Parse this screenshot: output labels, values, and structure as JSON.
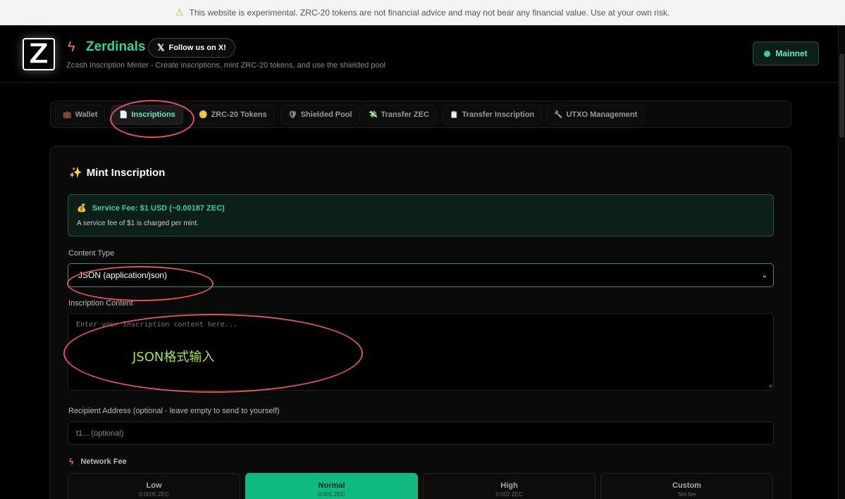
{
  "banner": {
    "icon": "warning-icon",
    "text": "This website is experimental. ZRC-20 tokens are not financial advice and may not bear any financial value. Use at your own risk."
  },
  "header": {
    "logo_text": "Z",
    "brand": "Zerdinals",
    "follow_label": "Follow us on X!",
    "x_icon": "𝕏",
    "subtitle": "Zcash Inscription Minter - Create inscriptions, mint ZRC-20 tokens, and use the shielded pool",
    "network_label": "Mainnet",
    "network_color": "#34d399"
  },
  "tabs": [
    {
      "label": "Wallet",
      "icon": "💼"
    },
    {
      "label": "Inscriptions",
      "icon": "📄",
      "active": true
    },
    {
      "label": "ZRC-20 Tokens",
      "icon": "🪙"
    },
    {
      "label": "Shielded Pool",
      "icon": "🛡"
    },
    {
      "label": "Transfer ZEC",
      "icon": "💸"
    },
    {
      "label": "Transfer Inscription",
      "icon": "📋"
    },
    {
      "label": "UTXO Management",
      "icon": "🔧"
    }
  ],
  "card": {
    "title": "Mint Inscription",
    "title_icon": "✨",
    "fee_icon": "💰",
    "fee_title": "Service Fee: $1 USD (~0.00187 ZEC)",
    "fee_desc": "A service fee of $1 is charged per mint.",
    "content_type_label": "Content Type",
    "content_type_value": "JSON (application/json)",
    "content_label": "Inscription Content",
    "content_placeholder": "Enter your inscription content here...",
    "annotation": "JSON格式输入",
    "recipient_label": "Recipient Address (optional - leave empty to send to yourself)",
    "recipient_placeholder": "t1... (optional)",
    "network_fee_label": "Network Fee",
    "fee_options": [
      {
        "label": "Low",
        "value": "0.0005 ZEC"
      },
      {
        "label": "Normal",
        "value": "0.001 ZEC",
        "selected": true
      },
      {
        "label": "High",
        "value": "0.002 ZEC"
      },
      {
        "label": "Custom",
        "value": "Set fee"
      }
    ]
  },
  "colors": {
    "accent": "#10b981",
    "brand": "#34d399",
    "annotation": "#e0525a"
  }
}
